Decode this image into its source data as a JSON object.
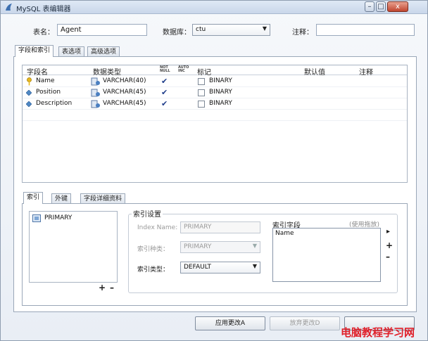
{
  "window": {
    "title": "MySQL 表编辑器",
    "controls": {
      "minimize": "–",
      "maximize": "□",
      "close": "x"
    }
  },
  "form": {
    "table_name_label": "表名：",
    "table_name_value": "Agent",
    "database_label": "数据库：",
    "database_value": "ctu",
    "comment_label": "注释：",
    "comment_value": ""
  },
  "tabs_top": [
    "字段和索引",
    "表选项",
    "高级选项"
  ],
  "grid": {
    "headers": {
      "name": "字段名",
      "type": "数据类型",
      "not_null": "NOT\nNULL",
      "auto_inc": "AUTO\nINC",
      "flags": "标记",
      "default": "默认值",
      "comment": "注释"
    },
    "rows": [
      {
        "name": "Name",
        "type": "VARCHAR(40)",
        "not_null": "✔",
        "flag": "BINARY",
        "icon": "key-icon"
      },
      {
        "name": "Position",
        "type": "VARCHAR(45)",
        "not_null": "✔",
        "flag": "BINARY",
        "icon": "diamond-icon"
      },
      {
        "name": "Description",
        "type": "VARCHAR(45)",
        "not_null": "✔",
        "flag": "BINARY",
        "icon": "diamond-icon"
      }
    ]
  },
  "tabs_bottom": [
    "索引",
    "外键",
    "字段详细资料"
  ],
  "index": {
    "list": [
      "PRIMARY"
    ],
    "add": "+",
    "remove": "–",
    "settings_title": "索引设置",
    "index_name_label": "Index Name:",
    "index_name_value": "PRIMARY",
    "index_kind_label": "索引种类：",
    "index_kind_value": "PRIMARY",
    "index_type_label": "索引类型：",
    "index_type_value": "DEFAULT",
    "fields_title": "索引字段",
    "fields_hint": "(使用拖放)",
    "fields": [
      "Name"
    ],
    "side_controls": {
      "right": "▸",
      "add": "+",
      "remove": "–"
    }
  },
  "buttons": {
    "apply": "应用更改A",
    "discard": "放弃更改D"
  },
  "watermark": "电脑教程学习网",
  "colors": {
    "watermark": "#e0202a",
    "check": "#1f3d8a"
  }
}
